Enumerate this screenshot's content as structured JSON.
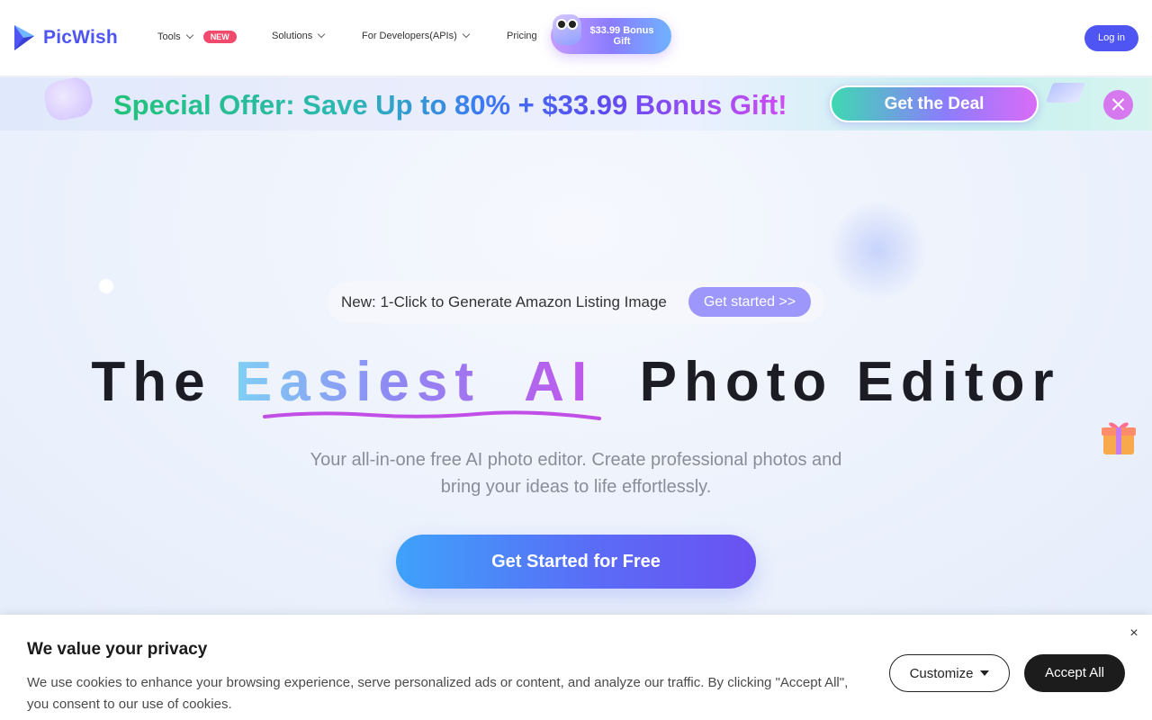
{
  "header": {
    "brand": "PicWish",
    "nav": [
      {
        "label": "Tools",
        "badge": "NEW"
      },
      {
        "label": "Solutions"
      },
      {
        "label": "For Developers(APIs)"
      },
      {
        "label": "Pricing"
      }
    ],
    "bonus_pill": "$33.99 Bonus Gift",
    "login": "Log in"
  },
  "promo": {
    "text": "Special Offer: Save Up to 80% + $33.99 Bonus Gift!",
    "button": "Get the Deal"
  },
  "hero": {
    "announcement": "New: 1-Click to Generate Amazon Listing Image",
    "announcement_button": "Get started >>",
    "headline": {
      "before": "The ",
      "highlight": "Easiest  AI",
      "after": "  Photo Editor"
    },
    "subtitle_line1": "Your all-in-one free AI photo editor. Create professional photos and",
    "subtitle_line2": "bring your ideas to life effortlessly.",
    "cta": "Get Started for Free"
  },
  "cookie": {
    "title": "We value your privacy",
    "body": "We use cookies to enhance your browsing experience, serve personalized ads or content, and analyze our traffic. By clicking \"Accept All\", you consent to our use of cookies.",
    "customize": "Customize",
    "accept": "Accept All",
    "close": "×"
  },
  "colors": {
    "brand": "#4e55f2",
    "badge": "#f24a6c",
    "cta_start": "#3ea2fb",
    "cta_end": "#6b51f2",
    "accept_bg": "#1c1c1c"
  },
  "icons": [
    "picwish-logo-icon",
    "chevron-down-icon",
    "close-icon",
    "caret-down-icon",
    "gift-icon"
  ]
}
